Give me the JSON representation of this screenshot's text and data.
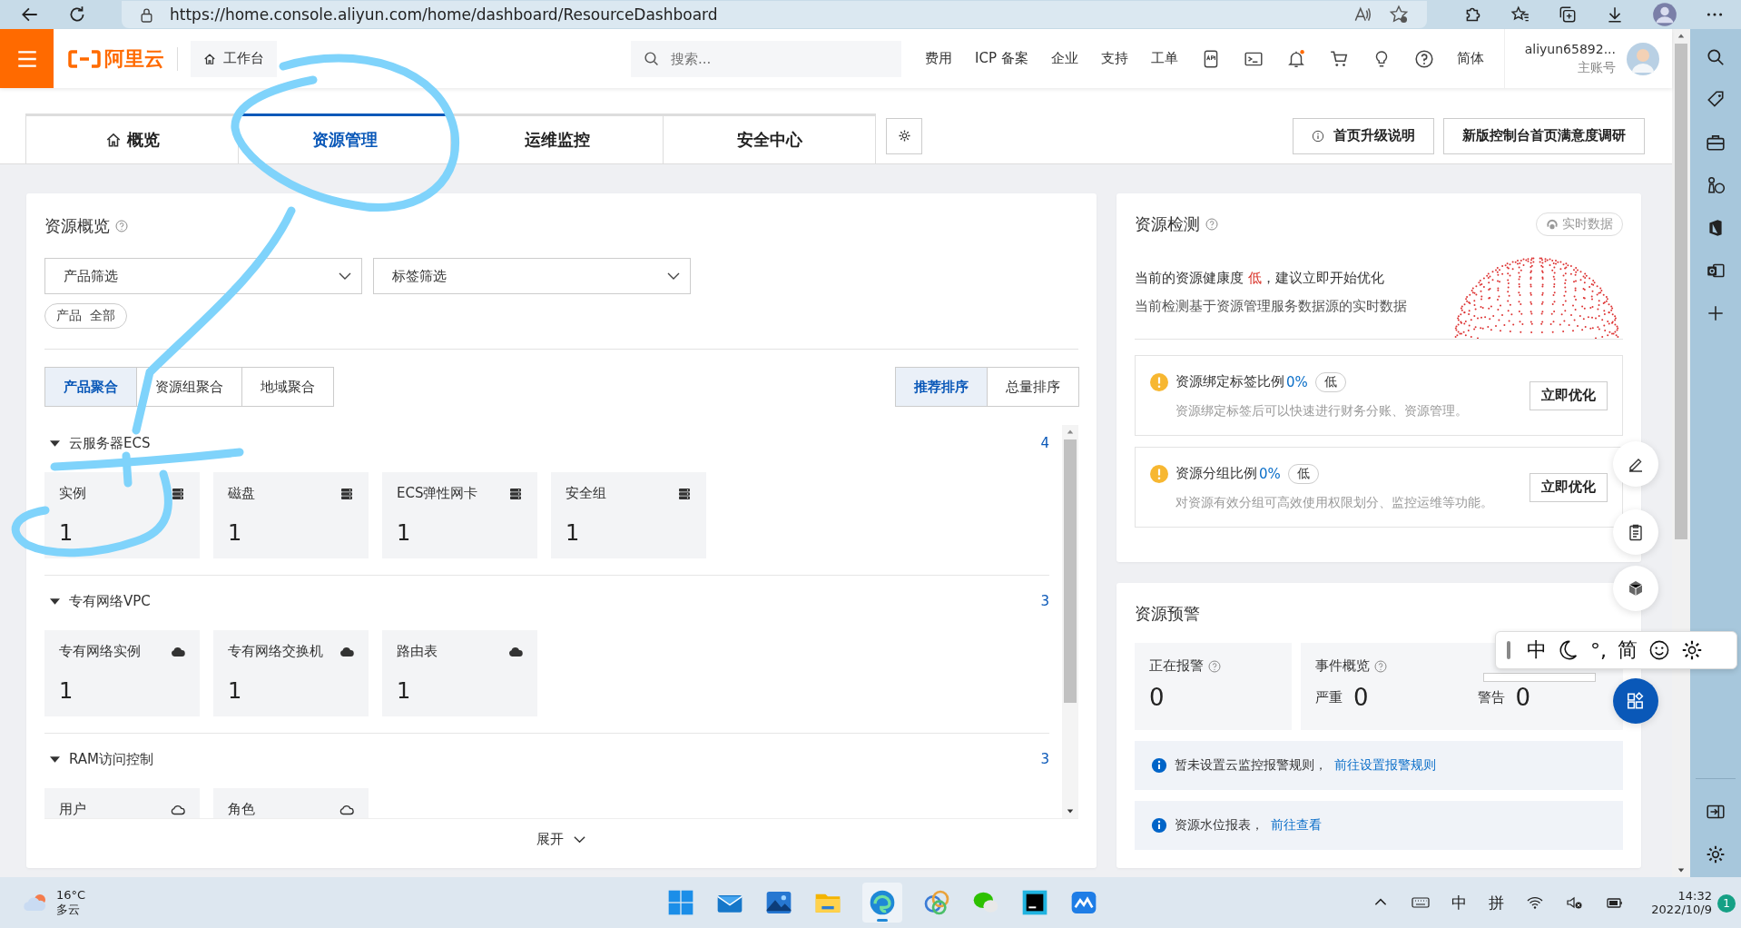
{
  "browser": {
    "url": "https://home.console.aliyun.com/home/dashboard/ResourceDashboard"
  },
  "header": {
    "logo": "阿里云",
    "workbench": "工作台",
    "search": {
      "placeholder": "搜索..."
    },
    "nav": [
      "费用",
      "ICP 备案",
      "企业",
      "支持",
      "工单"
    ],
    "language": "简体",
    "user": {
      "name": "aliyun65892...",
      "role": "主账号"
    }
  },
  "tabs": [
    {
      "label": "概览",
      "selected": false
    },
    {
      "label": "资源管理",
      "selected": true
    },
    {
      "label": "运维监控",
      "selected": false
    },
    {
      "label": "安全中心",
      "selected": false
    }
  ],
  "top_buttons": [
    {
      "label": "首页升级说明"
    },
    {
      "label": "新版控制台首页满意度调研"
    }
  ],
  "overview": {
    "title": "资源概览",
    "filters": [
      {
        "placeholder": "产品筛选"
      },
      {
        "placeholder": "标签筛选"
      }
    ],
    "filter_tag": {
      "label": "产品",
      "value": "全部"
    },
    "group_tabs": [
      {
        "label": "产品聚合",
        "selected": true
      },
      {
        "label": "资源组聚合",
        "selected": false
      },
      {
        "label": "地域聚合",
        "selected": false
      }
    ],
    "sort_tabs": [
      {
        "label": "推荐排序",
        "selected": true
      },
      {
        "label": "总量排序",
        "selected": false
      }
    ],
    "groups": [
      {
        "name": "云服务器ECS",
        "count": "4",
        "expanded": true,
        "tiles": [
          {
            "name": "实例",
            "value": "1",
            "kind": "server"
          },
          {
            "name": "磁盘",
            "value": "1",
            "kind": "server"
          },
          {
            "name": "ECS弹性网卡",
            "value": "1",
            "kind": "server"
          },
          {
            "name": "安全组",
            "value": "1",
            "kind": "server"
          }
        ]
      },
      {
        "name": "专有网络VPC",
        "count": "3",
        "expanded": true,
        "tiles": [
          {
            "name": "专有网络实例",
            "value": "1",
            "kind": "cloud-filled"
          },
          {
            "name": "专有网络交换机",
            "value": "1",
            "kind": "cloud-filled"
          },
          {
            "name": "路由表",
            "value": "1",
            "kind": "cloud-filled"
          }
        ]
      },
      {
        "name": "RAM访问控制",
        "count": "3",
        "expanded": true,
        "tiles": [
          {
            "name": "用户",
            "kind": "cloud-outline"
          },
          {
            "name": "角色",
            "kind": "cloud-outline"
          }
        ]
      }
    ],
    "expand": "展开"
  },
  "detection": {
    "title": "资源检测",
    "badge": "实时数据",
    "health_prefix": "当前的资源健康度",
    "health_level": "低",
    "health_suffix": "，建议立即开始优化",
    "note": "当前检测基于资源管理服务数据源的实时数据",
    "checks": [
      {
        "title": "资源绑定标签比例",
        "percent": "0%",
        "level": "低",
        "description": "资源绑定标签后可以快速进行财务分账、资源管理。",
        "action": "立即优化"
      },
      {
        "title": "资源分组比例",
        "percent": "0%",
        "level": "低",
        "description": "对资源有效分组可高效使用权限划分、监控运维等功能。",
        "action": "立即优化"
      }
    ]
  },
  "alerts": {
    "title": "资源预警",
    "active": {
      "label": "正在报警",
      "value": "0"
    },
    "events": {
      "label": "事件概览",
      "severe_label": "严重",
      "severe": "0",
      "warning_label": "警告",
      "warning": "0"
    },
    "notices": [
      {
        "text": "暂未设置云监控报警规则，",
        "link": "前往设置报警规则"
      },
      {
        "text": "资源水位报表，",
        "link": "前往查看"
      }
    ]
  },
  "ime": {
    "mode": "中",
    "punct": "°,",
    "script": "简"
  },
  "taskbar": {
    "temperature": "16°C",
    "weather": "多云",
    "tray": [
      "中",
      "拼"
    ],
    "time": "14:32",
    "date": "2022/10/9",
    "notifications": "1"
  }
}
